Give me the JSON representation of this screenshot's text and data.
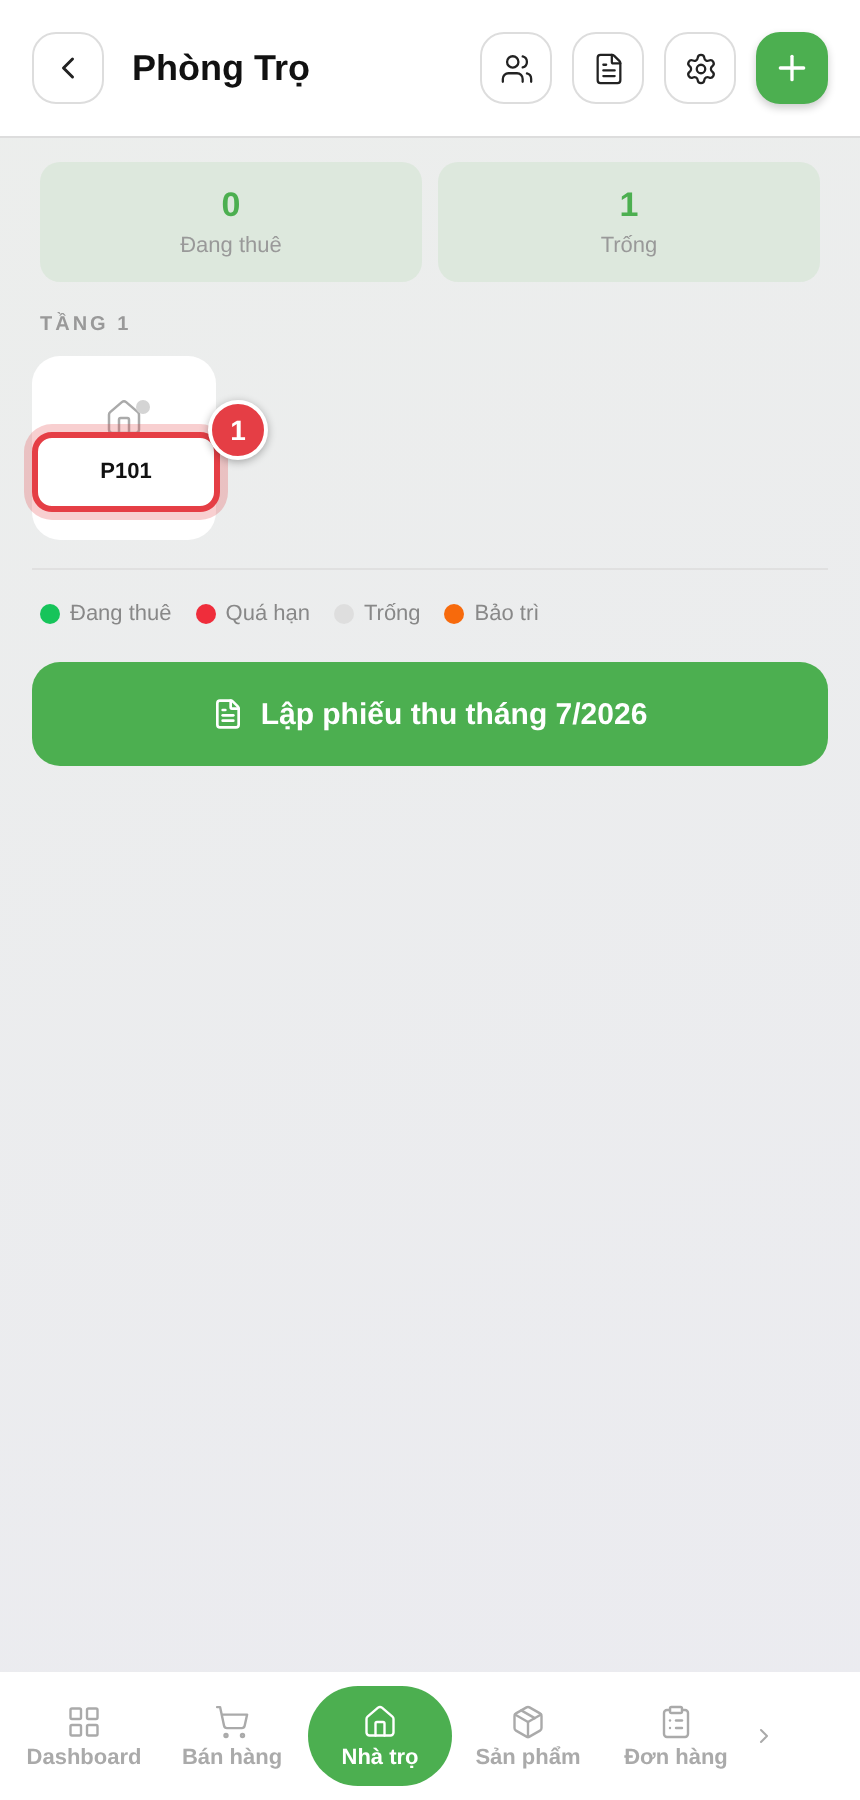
{
  "header": {
    "title": "Phòng Trọ"
  },
  "stats": [
    {
      "value": "0",
      "label": "Đang thuê"
    },
    {
      "value": "1",
      "label": "Trống"
    }
  ],
  "floors": [
    {
      "title": "TẦNG 1",
      "rooms": [
        {
          "name": "P101",
          "highlighted": true,
          "badge": "1",
          "color": "#d4d4d4"
        }
      ]
    }
  ],
  "legend": [
    {
      "label": "Đang thuê",
      "color": "#16c45a"
    },
    {
      "label": "Quá hạn",
      "color": "#ef2d3b"
    },
    {
      "label": "Trống",
      "color": "#dedede"
    },
    {
      "label": "Bảo trì",
      "color": "#f76a0c"
    }
  ],
  "action_button": "Lập phiếu thu tháng 7/2026",
  "nav": [
    {
      "kind": "grid",
      "label": "Dashboard",
      "selected": false
    },
    {
      "kind": "cart",
      "label": "Bán hàng",
      "selected": false
    },
    {
      "kind": "home",
      "label": "Nhà trọ",
      "selected": true
    },
    {
      "kind": "box",
      "label": "Sản phẩm",
      "selected": false
    },
    {
      "kind": "clipboard",
      "label": "Đơn hàng",
      "selected": false
    }
  ]
}
